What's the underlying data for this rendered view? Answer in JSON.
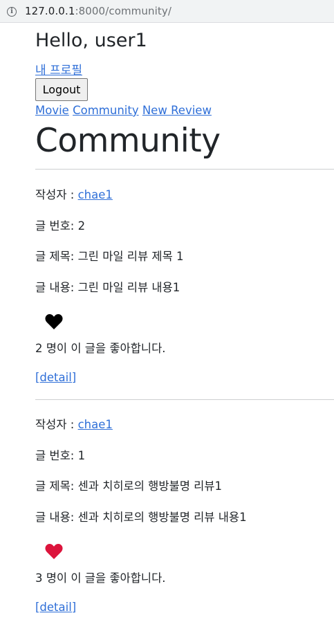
{
  "browser": {
    "url_host": "127.0.0.1",
    "url_rest": ":8000/community/"
  },
  "header": {
    "greeting": "Hello, user1",
    "profile_link": "내 프로필",
    "logout_label": "Logout"
  },
  "nav": {
    "movie": "Movie",
    "community": "Community",
    "new_review": "New Review"
  },
  "page_title": "Community",
  "labels": {
    "author": "작성자 : ",
    "post_number": "글 번호: ",
    "post_title": "글 제목: ",
    "post_content": "글 내용: ",
    "likes_suffix": " 명이 이 글을 좋아합니다.",
    "detail": "[detail]"
  },
  "posts": [
    {
      "author": "chae1",
      "number": "2",
      "title": "그린 마일 리뷰 제목 1",
      "content": "그린 마일 리뷰 내용1",
      "liked": false,
      "heart_color": "#000000",
      "likes": "2"
    },
    {
      "author": "chae1",
      "number": "1",
      "title": "센과 치히로의 행방불명 리뷰1",
      "content": "센과 치히로의 행방불명 리뷰 내용1",
      "liked": true,
      "heart_color": "#dc143c",
      "likes": "3"
    }
  ],
  "colors": {
    "link": "#2f6fd8",
    "text": "#212529"
  }
}
